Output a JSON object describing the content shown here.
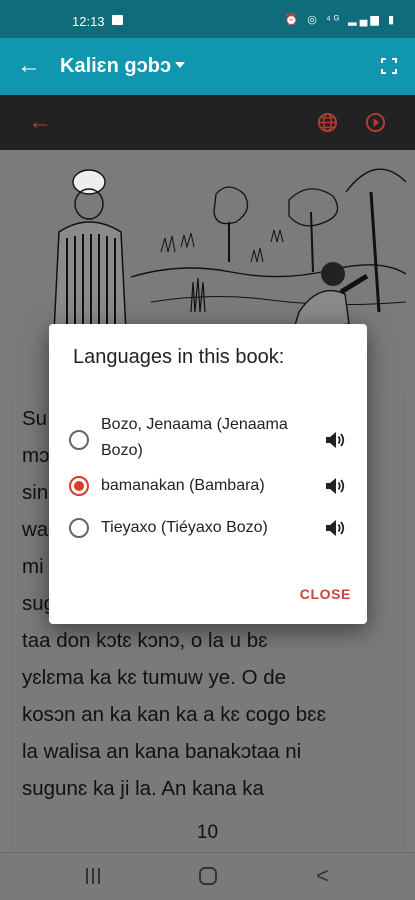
{
  "status_bar": {
    "time": "12:13",
    "indicators": "⏰ ◎ ⁴ᴳ ▂▄▆ ▮"
  },
  "app_bar": {
    "title": "Kaliɛn gɔbɔ",
    "back_icon": "arrow-left-icon",
    "fullscreen_icon": "fullscreen-icon"
  },
  "toolbar": {
    "back_symbol": "←",
    "globe_icon": "globe-icon",
    "play_icon": "play-icon"
  },
  "story": {
    "text": "Su ... tig ... se\nmɔ ...\nsin ... a\nwa ...\nmi ... i a\nsugunɛ la, u bɛ bɔ. U bɛ sɔrɔ ka\ntaa don kɔtɛ kɔnɔ, o la u bɛ\nyɛlɛma ka kɛ tumuw ye. O de\nkosɔn an ka kan ka a kɛ cogo bɛɛ\nla walisa an kana banakɔtaa ni\nsugunɛ ka ji la. An kana ka",
    "page_number": "10"
  },
  "dialog": {
    "title": "Languages in this book:",
    "languages": [
      {
        "label": "Bozo, Jenaama (Jenaama Bozo)",
        "selected": false
      },
      {
        "label": "bamanakan (Bambara)",
        "selected": true
      },
      {
        "label": "Tieyaxo (Tiéyaxo Bozo)",
        "selected": false
      }
    ],
    "close_label": "CLOSE"
  },
  "colors": {
    "app_bar": "#1096ae",
    "status_bar": "#0f6c7b",
    "accent": "#d93a2a",
    "toolbar": "#222222"
  }
}
